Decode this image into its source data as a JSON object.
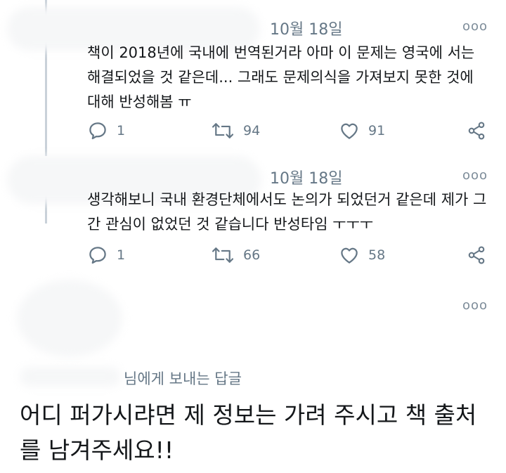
{
  "tweets": [
    {
      "date": "10월 18일",
      "more": "ooo",
      "text": "책이 2018년에 국내에 번역된거라 아마 이 문제는 영국에 서는 해결되었을 것 같은데... 그래도 문제의식을 가져보지 못한 것에 대해 반성해봄 ㅠ",
      "replies": "1",
      "retweets": "94",
      "likes": "91"
    },
    {
      "date": "10월 18일",
      "more": "ooo",
      "text": "생각해보니 국내 환경단체에서도 논의가 되었던거 같은데 제가 그간 관심이 없었던 것 같습니다 반성타임 ㅜㅜㅜ",
      "replies": "1",
      "retweets": "66",
      "likes": "58"
    }
  ],
  "composer": {
    "more": "ooo",
    "replying_to": "님에게 보내는 답글",
    "reply_text": "어디 퍼가시랴면 제 정보는 가려 주시고 책 출처를 남겨주세요!!"
  },
  "colors": {
    "text": "#14171a",
    "muted": "#657786",
    "thread_line": "#c9d1d9"
  },
  "icons": [
    "reply-icon",
    "retweet-icon",
    "like-icon",
    "share-icon",
    "more-icon"
  ]
}
